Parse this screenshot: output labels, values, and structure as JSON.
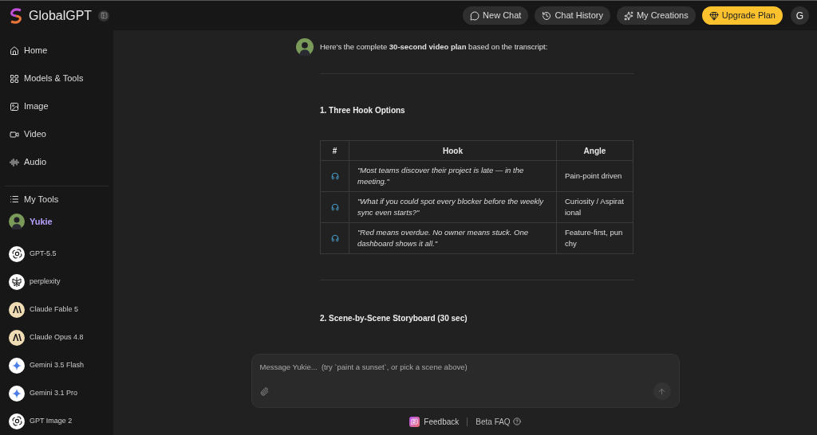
{
  "app": {
    "name": "GlobalGPT"
  },
  "header_buttons": [
    {
      "label": "New Chat",
      "kind": "chat"
    },
    {
      "label": "Chat History",
      "kind": "history"
    },
    {
      "label": "My Creations",
      "kind": "creations"
    },
    {
      "label": "Upgrade Plan",
      "kind": "upgrade"
    }
  ],
  "account": {
    "initial": "G"
  },
  "sidebar": {
    "items": [
      {
        "label": "Home",
        "kind": "home"
      },
      {
        "label": "Models & Tools",
        "kind": "grid"
      },
      {
        "label": "Image",
        "kind": "image"
      },
      {
        "label": "Video",
        "kind": "video"
      },
      {
        "label": "Audio",
        "kind": "audio"
      }
    ],
    "my_tools": {
      "label": "My Tools"
    },
    "active_tool": {
      "label": "Yukie",
      "selected": true
    },
    "models": [
      {
        "label": "GPT-5.5",
        "kind": "openai"
      },
      {
        "label": "perplexity",
        "kind": "perplexity"
      },
      {
        "label": "Claude Fable 5",
        "kind": "anthropic"
      },
      {
        "label": "Claude Opus 4.8",
        "kind": "anthropic"
      },
      {
        "label": "Gemini 3.5 Flash",
        "kind": "gemini"
      },
      {
        "label": "Gemini 3.1 Pro",
        "kind": "gemini"
      },
      {
        "label": "GPT Image 2",
        "kind": "openai"
      }
    ]
  },
  "message": {
    "intro": "Here's the complete **30-second video plan** based on the transcript:",
    "section_1": "1. Three Hook Options",
    "table": {
      "columns": [
        "#",
        "Hook",
        "Angle"
      ],
      "rows": [
        {
          "hook": "\"Most teams discover their project is late — in the meeting.\"",
          "angle": "Pain-point driven"
        },
        {
          "hook": "\"What if you could spot every blocker before the weekly sync even starts?\"",
          "angle": "Curiosity / Aspirational"
        },
        {
          "hook": "\"Red means overdue. No owner means stuck. One dashboard shows it all.\"",
          "angle": "Feature-first, punchy"
        }
      ]
    },
    "section_2": "2. Scene-by-Scene Storyboard (30 sec)"
  },
  "composer": {
    "placeholder": "Message Yukie...  (try `paint a sunset`, or pick a scene above)"
  },
  "footer": {
    "feedback": "Feedback",
    "faq": "Beta FAQ"
  }
}
